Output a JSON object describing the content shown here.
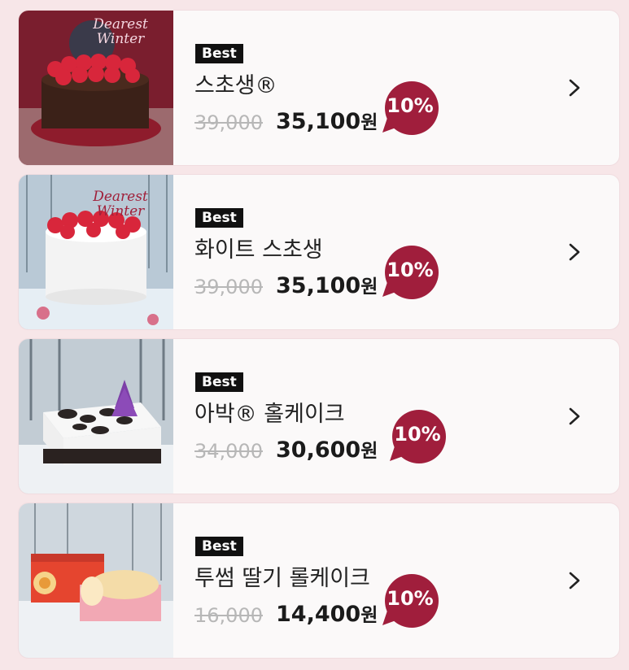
{
  "products": [
    {
      "badge": "Best",
      "name": "스초생®",
      "original_price": "39,000",
      "price": "35,100",
      "currency": "원",
      "discount": "10%"
    },
    {
      "badge": "Best",
      "name": "화이트 스초생",
      "original_price": "39,000",
      "price": "35,100",
      "currency": "원",
      "discount": "10%"
    },
    {
      "badge": "Best",
      "name": "아박® 홀케이크",
      "original_price": "34,000",
      "price": "30,600",
      "currency": "원",
      "discount": "10%"
    },
    {
      "badge": "Best",
      "name": "투썸 딸기 롤케이크",
      "original_price": "16,000",
      "price": "14,400",
      "currency": "원",
      "discount": "10%"
    }
  ],
  "image_captions": {
    "dearest_winter_line1": "Dearest",
    "dearest_winter_line2": "Winter"
  },
  "colors": {
    "discount_badge": "#a01e3c",
    "best_badge": "#111111",
    "page_bg": "#f7e6e8"
  },
  "icons": {
    "chevron": "chevron-right-icon"
  }
}
